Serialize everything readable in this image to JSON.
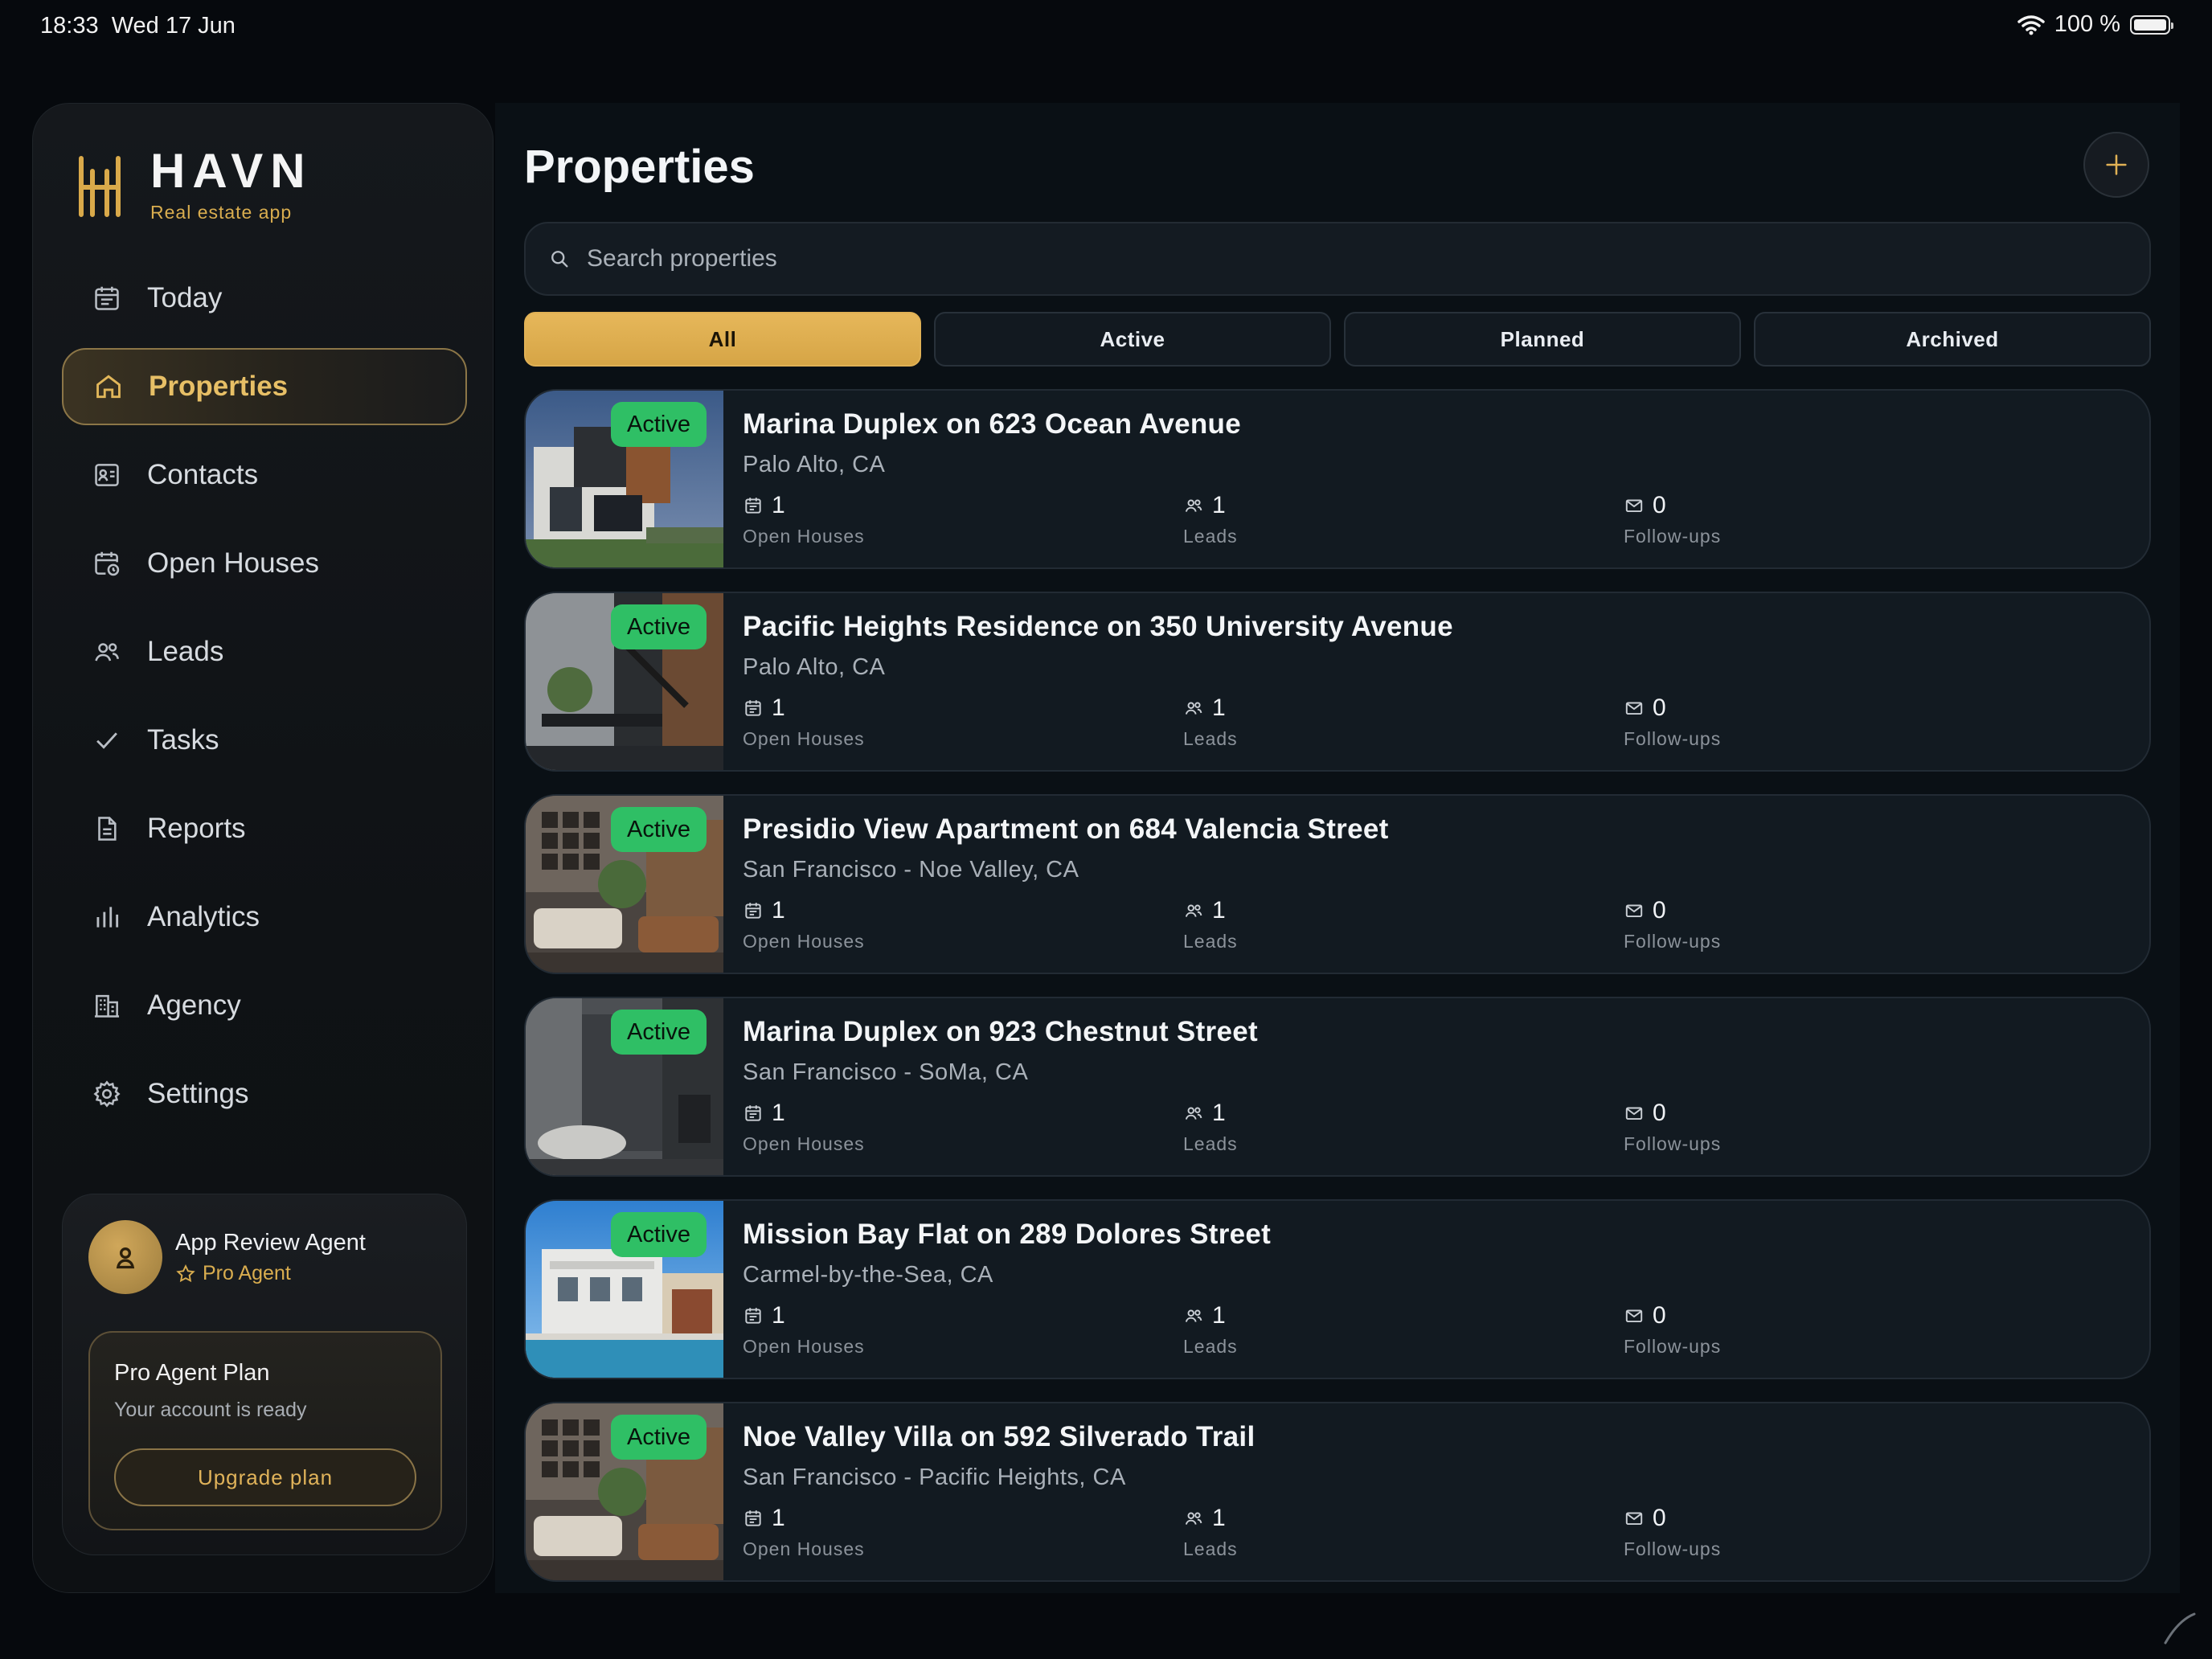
{
  "status_bar": {
    "time": "18:33",
    "date": "Wed 17 Jun",
    "battery": "100 %"
  },
  "brand": {
    "name": "HAVN",
    "subtitle": "Real estate app"
  },
  "nav": [
    {
      "label": "Today",
      "icon": "calendar-icon"
    },
    {
      "label": "Properties",
      "icon": "home-icon",
      "active": true
    },
    {
      "label": "Contacts",
      "icon": "contact-card-icon"
    },
    {
      "label": "Open Houses",
      "icon": "calendar-clock-icon"
    },
    {
      "label": "Leads",
      "icon": "users-icon"
    },
    {
      "label": "Tasks",
      "icon": "check-icon"
    },
    {
      "label": "Reports",
      "icon": "document-icon"
    },
    {
      "label": "Analytics",
      "icon": "bar-chart-icon"
    },
    {
      "label": "Agency",
      "icon": "building-icon"
    },
    {
      "label": "Settings",
      "icon": "gear-icon"
    }
  ],
  "profile": {
    "name": "App Review Agent",
    "role": "Pro Agent"
  },
  "plan": {
    "title": "Pro Agent Plan",
    "subtitle": "Your account is ready",
    "button": "Upgrade plan"
  },
  "page": {
    "title": "Properties"
  },
  "search": {
    "placeholder": "Search properties"
  },
  "filters": [
    "All",
    "Active",
    "Planned",
    "Archived"
  ],
  "stat_labels": {
    "open_houses": "Open Houses",
    "leads": "Leads",
    "followups": "Follow-ups"
  },
  "properties": [
    {
      "status": "Active",
      "title": "Marina Duplex on 623 Ocean Avenue",
      "location": "Palo Alto, CA",
      "open_houses": "1",
      "leads": "1",
      "followups": "0"
    },
    {
      "status": "Active",
      "title": "Pacific Heights Residence on 350 University Avenue",
      "location": "Palo Alto, CA",
      "open_houses": "1",
      "leads": "1",
      "followups": "0"
    },
    {
      "status": "Active",
      "title": "Presidio View Apartment on 684 Valencia Street",
      "location": "San Francisco - Noe Valley, CA",
      "open_houses": "1",
      "leads": "1",
      "followups": "0"
    },
    {
      "status": "Active",
      "title": "Marina Duplex on 923 Chestnut Street",
      "location": "San Francisco - SoMa, CA",
      "open_houses": "1",
      "leads": "1",
      "followups": "0"
    },
    {
      "status": "Active",
      "title": "Mission Bay Flat on 289 Dolores Street",
      "location": "Carmel-by-the-Sea, CA",
      "open_houses": "1",
      "leads": "1",
      "followups": "0"
    },
    {
      "status": "Active",
      "title": "Noe Valley Villa on 592 Silverado Trail",
      "location": "San Francisco - Pacific Heights, CA",
      "open_houses": "1",
      "leads": "1",
      "followups": "0"
    }
  ],
  "colors": {
    "accent": "#e0b155",
    "active_badge": "#2fbf65",
    "background": "#06090d"
  }
}
